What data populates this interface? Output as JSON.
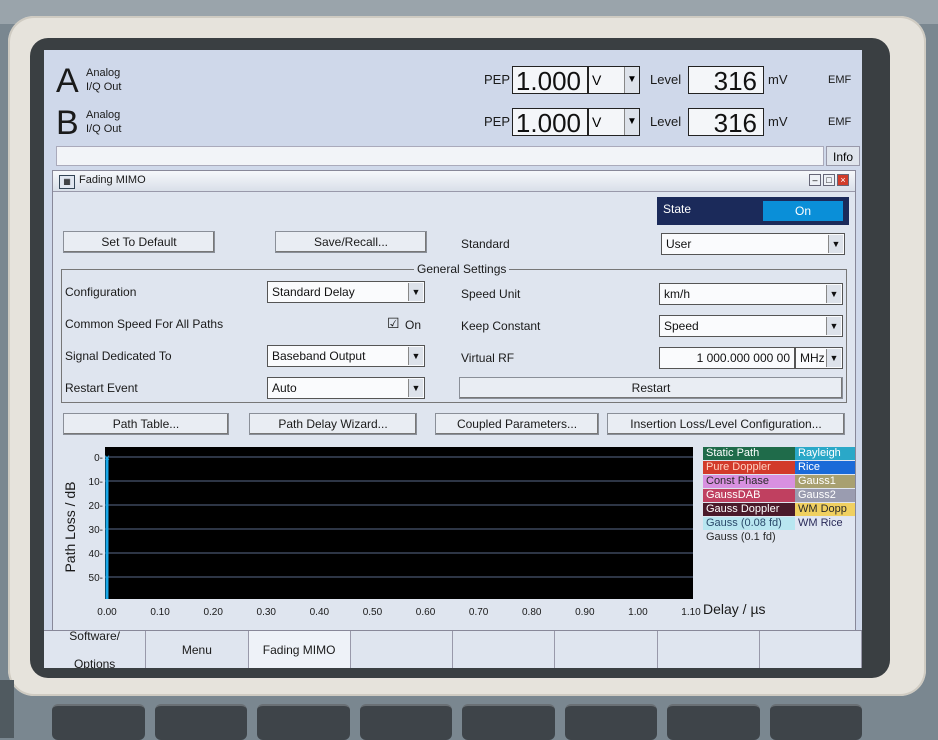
{
  "channels": [
    {
      "letter": "A",
      "sub1": "Analog",
      "sub2": "I/Q Out",
      "pep_label": "PEP",
      "pep_value": "1.000",
      "pep_unit": "V",
      "level_label": "Level",
      "level_value": "316",
      "level_unit": "mV",
      "emf": "EMF"
    },
    {
      "letter": "B",
      "sub1": "Analog",
      "sub2": "I/Q Out",
      "pep_label": "PEP",
      "pep_value": "1.000",
      "pep_unit": "V",
      "level_label": "Level",
      "level_value": "316",
      "level_unit": "mV",
      "emf": "EMF"
    }
  ],
  "info_label": "Info",
  "dialog": {
    "title": "Fading MIMO",
    "state_label": "State",
    "state_value": "On",
    "set_default": "Set To Default",
    "save_recall": "Save/Recall...",
    "standard_label": "Standard",
    "standard_value": "User",
    "group_title": "General Settings",
    "configuration_label": "Configuration",
    "configuration_value": "Standard Delay",
    "speed_unit_label": "Speed Unit",
    "speed_unit_value": "km/h",
    "common_speed_label": "Common Speed For All Paths",
    "common_speed_check": "☑",
    "common_speed_value": "On",
    "keep_constant_label": "Keep Constant",
    "keep_constant_value": "Speed",
    "signal_dedicated_label": "Signal Dedicated To",
    "signal_dedicated_value": "Baseband Output",
    "virtual_rf_label": "Virtual RF",
    "virtual_rf_value": "1 000.000 000 00",
    "virtual_rf_unit": "MHz",
    "restart_event_label": "Restart Event",
    "restart_event_value": "Auto",
    "restart_button": "Restart",
    "path_table": "Path Table...",
    "path_delay_wizard": "Path Delay Wizard...",
    "coupled_params": "Coupled Parameters...",
    "insertion_loss": "Insertion Loss/Level Configuration..."
  },
  "chart_data": {
    "type": "bar",
    "ylabel": "Path Loss / dB",
    "xlabel": "Delay  / µs",
    "x_ticks": [
      "0.00",
      "0.10",
      "0.20",
      "0.30",
      "0.40",
      "0.50",
      "0.60",
      "0.70",
      "0.80",
      "0.90",
      "1.00",
      "1.10"
    ],
    "y_ticks": [
      "0-",
      "10-",
      "20-",
      "30-",
      "40-",
      "50-"
    ],
    "xlim": [
      0,
      1.1
    ],
    "ylim": [
      0,
      60
    ],
    "paths": [
      {
        "delay": 0.0,
        "loss": 0
      }
    ],
    "colors": {
      "background": "#000000",
      "grid": "#5a6a8a",
      "path": "#1aa8e8"
    }
  },
  "legend": [
    {
      "text": "Static Path",
      "bg": "#1f6b4a",
      "fg": "#ffffff",
      "col": 0,
      "row": 0
    },
    {
      "text": "Rayleigh",
      "bg": "#2aa8c8",
      "fg": "#ffffff",
      "col": 1,
      "row": 0
    },
    {
      "text": "Pure Doppler",
      "bg": "#d23a2a",
      "fg": "#ffd0c0",
      "col": 0,
      "row": 1
    },
    {
      "text": "Rice",
      "bg": "#1a6ad8",
      "fg": "#ffffff",
      "col": 1,
      "row": 1
    },
    {
      "text": "Const Phase",
      "bg": "#d890e0",
      "fg": "#2a2a2a",
      "col": 0,
      "row": 2
    },
    {
      "text": "Gauss1",
      "bg": "#a8a070",
      "fg": "#ffffff",
      "col": 1,
      "row": 2
    },
    {
      "text": "GaussDAB",
      "bg": "#c04060",
      "fg": "#ffffff",
      "col": 0,
      "row": 3
    },
    {
      "text": "Gauss2",
      "bg": "#9a9cb0",
      "fg": "#ffffff",
      "col": 1,
      "row": 3
    },
    {
      "text": "Gauss Doppler",
      "bg": "#4a1a2a",
      "fg": "#ffffff",
      "col": 0,
      "row": 4
    },
    {
      "text": "WM Dopp",
      "bg": "#f0d060",
      "fg": "#2a2a2a",
      "col": 1,
      "row": 4
    },
    {
      "text": "Gauss (0.08 fd)",
      "bg": "#b8e6f0",
      "fg": "#2a4a6a",
      "col": 0,
      "row": 5
    },
    {
      "text": "WM Rice",
      "bg": "#e0e6f2",
      "fg": "#2a2a5a",
      "col": 1,
      "row": 5
    },
    {
      "text": "Gauss (0.1 fd)",
      "bg": "#dfe5ef",
      "fg": "#2a2a2a",
      "col": 0,
      "row": 6
    }
  ],
  "bottom_tabs": [
    {
      "line1": "Software/",
      "line2": "Options"
    },
    {
      "line1": "Menu",
      "line2": ""
    },
    {
      "line1": "Fading MIMO",
      "line2": ""
    },
    {
      "line1": "",
      "line2": ""
    },
    {
      "line1": "",
      "line2": ""
    },
    {
      "line1": "",
      "line2": ""
    },
    {
      "line1": "",
      "line2": ""
    },
    {
      "line1": "",
      "line2": ""
    }
  ]
}
